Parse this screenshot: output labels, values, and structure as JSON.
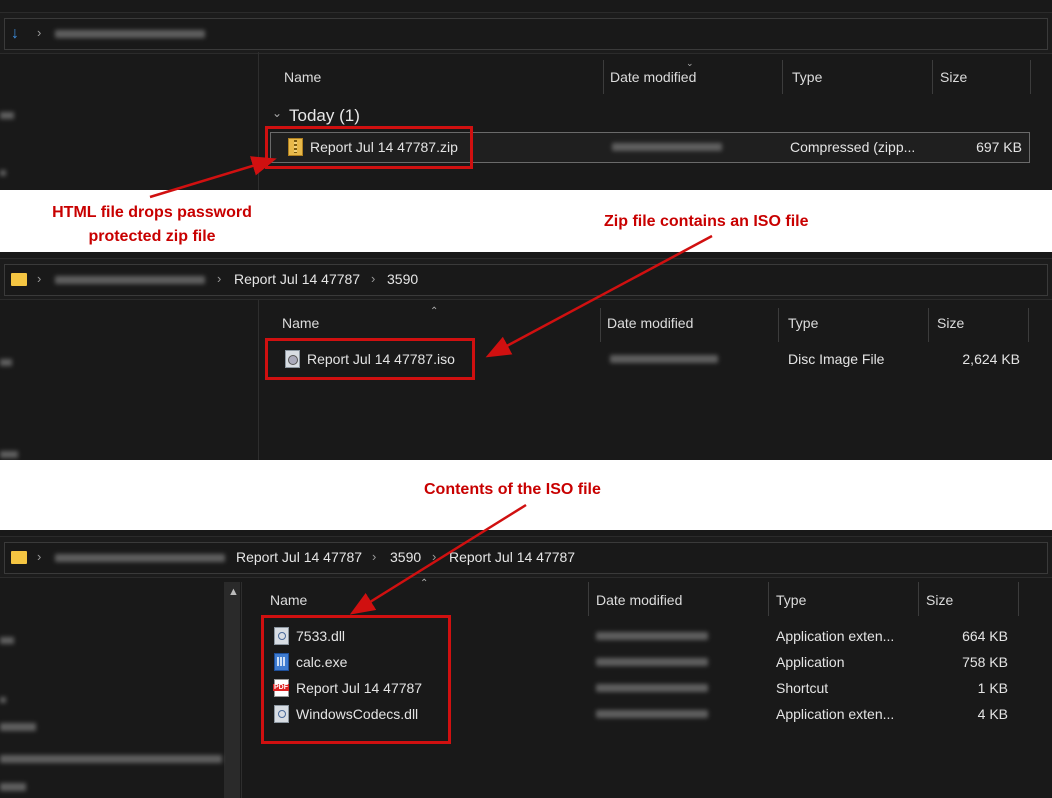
{
  "panel1": {
    "columns": {
      "name": "Name",
      "date": "Date modified",
      "type": "Type",
      "size": "Size"
    },
    "group_label": "Today (1)",
    "file": {
      "name": "Report Jul 14 47787.zip",
      "type": "Compressed (zipp...",
      "size": "697 KB",
      "icon": "zip-icon"
    }
  },
  "panel2": {
    "breadcrumb": [
      "Report Jul 14 47787",
      "3590"
    ],
    "columns": {
      "name": "Name",
      "date": "Date modified",
      "type": "Type",
      "size": "Size"
    },
    "file": {
      "name": "Report Jul 14 47787.iso",
      "type": "Disc Image File",
      "size": "2,624 KB",
      "icon": "disc-image-icon"
    }
  },
  "panel3": {
    "breadcrumb": [
      "Report Jul 14 47787",
      "3590",
      "Report Jul 14 47787"
    ],
    "columns": {
      "name": "Name",
      "date": "Date modified",
      "type": "Type",
      "size": "Size"
    },
    "files": [
      {
        "name": "7533.dll",
        "type": "Application exten...",
        "size": "664 KB",
        "icon": "dll-icon"
      },
      {
        "name": "calc.exe",
        "type": "Application",
        "size": "758 KB",
        "icon": "calculator-icon"
      },
      {
        "name": "Report Jul 14 47787",
        "type": "Shortcut",
        "size": "1 KB",
        "icon": "pdf-icon"
      },
      {
        "name": "WindowsCodecs.dll",
        "type": "Application exten...",
        "size": "4 KB",
        "icon": "dll-icon"
      }
    ]
  },
  "annotations": {
    "note1_line1": "HTML file drops password",
    "note1_line2": "protected zip file",
    "note2": "Zip file contains an ISO file",
    "note3": "Contents of the ISO file",
    "color": "#c80000"
  }
}
